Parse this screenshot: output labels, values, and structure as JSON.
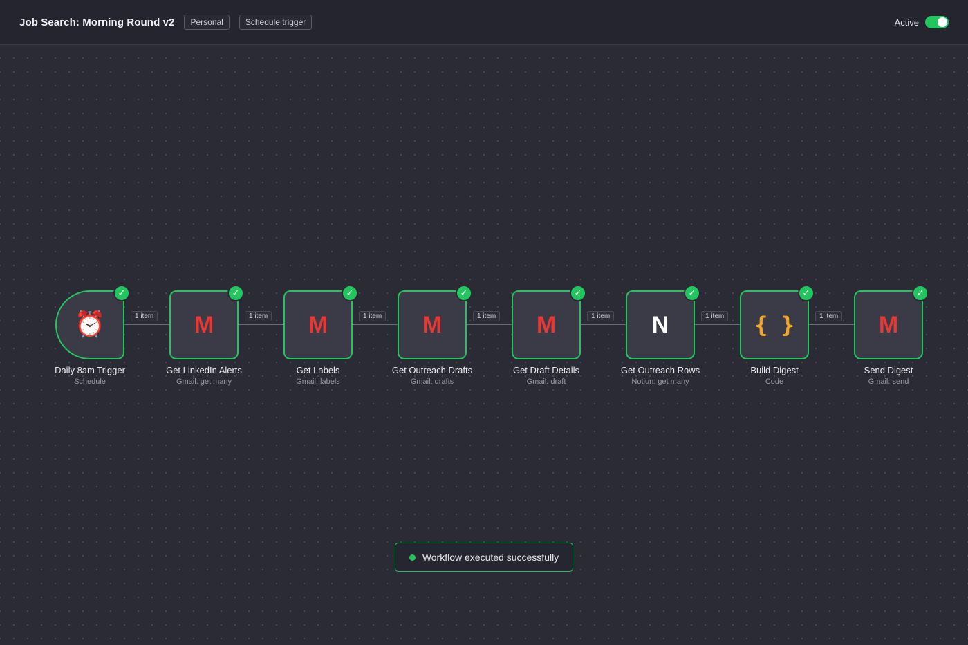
{
  "header": {
    "title": "Job Search: Morning Round v2",
    "tags": [
      "Personal",
      "Schedule trigger"
    ],
    "active_label": "Active",
    "active": true
  },
  "colors": {
    "accent": "#22c55e",
    "gmail": "#e53935",
    "code": "#f5a623"
  },
  "nodes": [
    {
      "name": "Daily 8am Trigger",
      "subtitle": "Schedule",
      "icon": "alarm-clock-icon",
      "glyph": "⏰",
      "status": "success"
    },
    {
      "name": "Get LinkedIn Alerts",
      "subtitle": "Gmail: get many",
      "icon": "gmail-icon",
      "glyph": "M",
      "status": "success"
    },
    {
      "name": "Get Labels",
      "subtitle": "Gmail: labels",
      "icon": "gmail-icon",
      "glyph": "M",
      "status": "success"
    },
    {
      "name": "Get Outreach Drafts",
      "subtitle": "Gmail: drafts",
      "icon": "gmail-icon",
      "glyph": "M",
      "status": "success"
    },
    {
      "name": "Get Draft Details",
      "subtitle": "Gmail: draft",
      "icon": "gmail-icon",
      "glyph": "M",
      "status": "success"
    },
    {
      "name": "Get Outreach Rows",
      "subtitle": "Notion: get many",
      "icon": "notion-icon",
      "glyph": "N",
      "status": "success"
    },
    {
      "name": "Build Digest",
      "subtitle": "Code",
      "icon": "code-icon",
      "glyph": "{ }",
      "status": "success"
    },
    {
      "name": "Send Digest",
      "subtitle": "Gmail: send",
      "icon": "gmail-icon",
      "glyph": "M",
      "status": "success"
    }
  ],
  "edges": [
    {
      "label": "1 item"
    },
    {
      "label": "1 item"
    },
    {
      "label": "1 item"
    },
    {
      "label": "1 item"
    },
    {
      "label": "1 item"
    },
    {
      "label": "1 item"
    },
    {
      "label": "1 item"
    }
  ],
  "check_glyph": "✓",
  "toast": {
    "message": "Workflow executed successfully"
  }
}
